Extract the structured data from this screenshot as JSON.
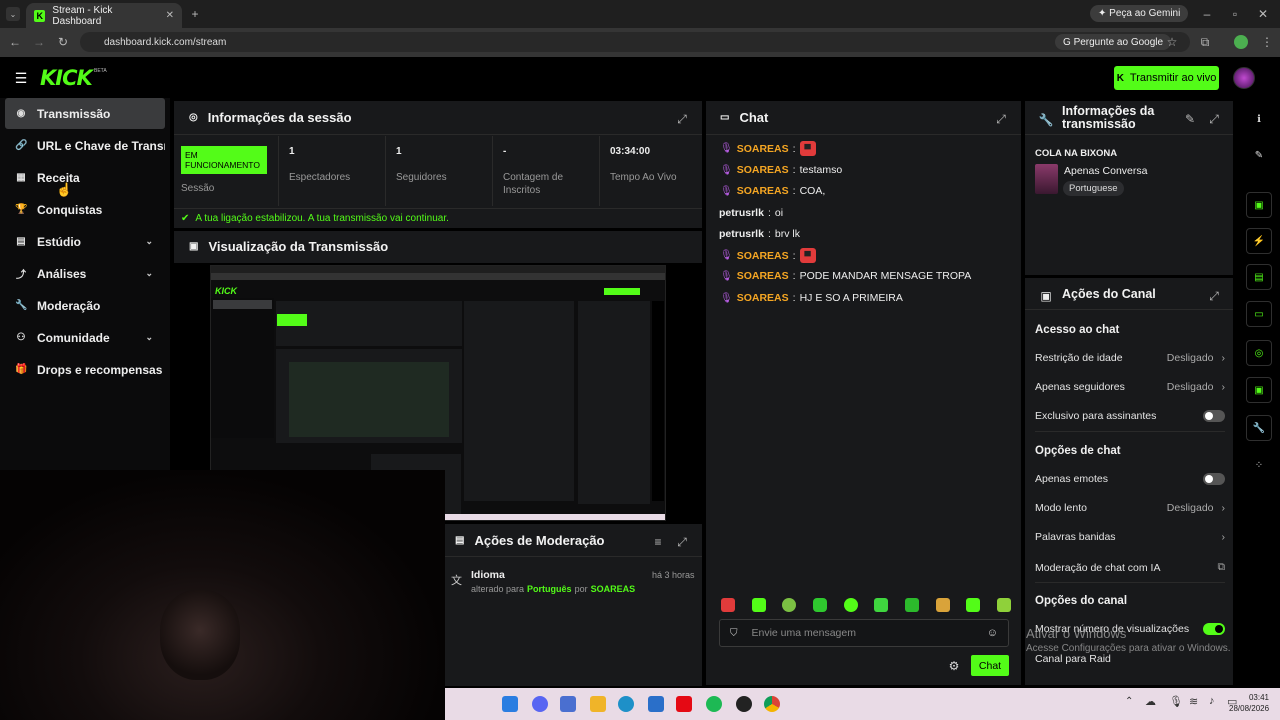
{
  "browser": {
    "tab_title": "Stream - Kick Dashboard",
    "url": "dashboard.kick.com/stream",
    "gemini_button": "Peça ao Gemini",
    "ask_google": "Pergunte ao Google"
  },
  "header": {
    "logo": "KICK",
    "beta": "BETA",
    "go_live": "Transmitir ao vivo"
  },
  "sidebar": {
    "items": [
      {
        "label": "Transmissão",
        "icon": "broadcast-icon"
      },
      {
        "label": "URL e Chave de Transmissão",
        "icon": "link-icon"
      },
      {
        "label": "Receita",
        "icon": "revenue-icon"
      },
      {
        "label": "Conquistas",
        "icon": "trophy-icon"
      },
      {
        "label": "Estúdio",
        "icon": "studio-icon"
      },
      {
        "label": "Análises",
        "icon": "analytics-icon"
      },
      {
        "label": "Moderação",
        "icon": "wrench-icon"
      },
      {
        "label": "Comunidade",
        "icon": "community-icon"
      },
      {
        "label": "Drops e recompensas",
        "icon": "gift-icon"
      }
    ]
  },
  "session": {
    "title": "Informações da sessão",
    "status_badge": "EM FUNCIONAMENTO",
    "status_label": "Sessão",
    "stats": [
      {
        "value": "1",
        "label": "Espectadores"
      },
      {
        "value": "1",
        "label": "Seguidores"
      },
      {
        "value": "-",
        "label": "Contagem de Inscritos"
      },
      {
        "value": "03:34:00",
        "label": "Tempo Ao Vivo"
      }
    ],
    "connection_msg": "A tua ligação estabilizou. A tua transmissão vai continuar."
  },
  "preview": {
    "title": "Visualização da Transmissão"
  },
  "moderation": {
    "title": "Ações de Moderação",
    "entry_title": "Idioma",
    "entry_time": "há 3 horas",
    "entry_prefix": "alterado para",
    "entry_value": "Português",
    "entry_by": "por",
    "entry_user": "SOAREAS"
  },
  "chat": {
    "title": "Chat",
    "messages": [
      {
        "user": "SOAREAS",
        "text": "",
        "emote": true
      },
      {
        "user": "SOAREAS",
        "text": "testamso",
        "emote": false
      },
      {
        "user": "SOAREAS",
        "text": "COA,",
        "emote": false
      },
      {
        "user": "petrusrlk",
        "text": "oi",
        "emote": false
      },
      {
        "user": "petrusrlk",
        "text": "brv lk",
        "emote": false
      },
      {
        "user": "SOAREAS",
        "text": "",
        "emote": true
      },
      {
        "user": "SOAREAS",
        "text": "PODE MANDAR MENSAGE TROPA",
        "emote": false
      },
      {
        "user": "SOAREAS",
        "text": "HJ E SO A PRIMEIRA",
        "emote": false
      }
    ],
    "input_placeholder": "Envie uma mensagem",
    "send_button": "Chat"
  },
  "stream_info": {
    "title_line1": "Informações da",
    "title_line2": "transmissão",
    "stream_title": "COLA NA BIXONA",
    "category": "Apenas Conversa",
    "language": "Portuguese"
  },
  "channel_actions": {
    "title": "Ações do Canal",
    "chat_access": "Acesso ao chat",
    "age_restriction": "Restrição de idade",
    "age_restriction_value": "Desligado",
    "followers_only": "Apenas seguidores",
    "followers_only_value": "Desligado",
    "subs_only": "Exclusivo para assinantes",
    "chat_options": "Opções de chat",
    "emotes_only": "Apenas emotes",
    "slow_mode": "Modo lento",
    "slow_mode_value": "Desligado",
    "banned_words": "Palavras banidas",
    "ai_moderation": "Moderação de chat com IA",
    "channel_options": "Opções do canal",
    "show_views": "Mostrar número de visualizações",
    "raid_channel": "Canal para Raid"
  },
  "watermark": {
    "line1": "Ativar o Windows",
    "line2": "Acesse Configurações para ativar o Windows."
  },
  "taskbar": {
    "time": "03:41",
    "date": "28/08/2026"
  },
  "colors": {
    "accent": "#53fc18",
    "panel": "#18191b",
    "username": "#f5a623"
  }
}
